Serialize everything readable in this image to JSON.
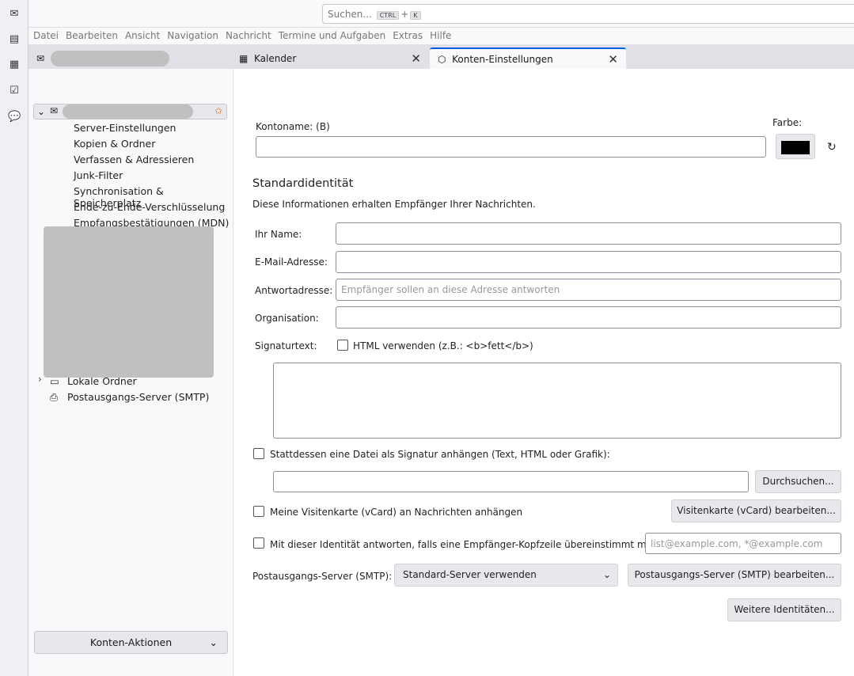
{
  "search": {
    "placeholder": "Suchen...",
    "key1": "CTRL",
    "plus": "+",
    "key2": "K"
  },
  "menu": [
    "Datei",
    "Bearbeiten",
    "Ansicht",
    "Navigation",
    "Nachricht",
    "Termine und Aufgaben",
    "Extras",
    "Hilfe"
  ],
  "tabs": [
    {
      "label": "Kalender"
    },
    {
      "label": "Konten-Einstellungen"
    }
  ],
  "sidebar": {
    "items": [
      "Server-Einstellungen",
      "Kopien & Ordner",
      "Verfassen & Adressieren",
      "Junk-Filter",
      "Synchronisation & Speicherplatz",
      "Ende-zu-Ende-Verschlüsselung",
      "Empfangsbestätigungen (MDN)"
    ],
    "local": "Lokale Ordner",
    "smtp": "Postausgangs-Server (SMTP)",
    "actions": "Konten-Aktionen"
  },
  "form": {
    "kontoname": "Kontoname: (B)",
    "farbe": "Farbe:",
    "color": "#000000",
    "heading": "Standardidentität",
    "desc": "Diese Informationen erhalten Empfänger Ihrer Nachrichten.",
    "name": "Ihr Name:",
    "email": "E-Mail-Adresse:",
    "reply": "Antwortadresse:",
    "reply_ph": "Empfänger sollen an diese Adresse antworten",
    "org": "Organisation:",
    "sig": "Signaturtext:",
    "html": "HTML verwenden (z.B.: <b>fett</b>)",
    "sigfile": "Stattdessen eine Datei als Signatur anhängen (Text, HTML oder Grafik):",
    "browse": "Durchsuchen...",
    "vcard": "Meine Visitenkarte (vCard) an Nachrichten anhängen",
    "vcard_btn": "Visitenkarte (vCard) bearbeiten...",
    "match": "Mit dieser Identität antworten, falls eine Empfänger-Kopfzeile übereinstimmt mit:",
    "match_ph": "list@example.com, *@example.com",
    "smtp": "Postausgangs-Server (SMTP):",
    "smtp_val": "Standard-Server verwenden",
    "smtp_btn": "Postausgangs-Server (SMTP) bearbeiten...",
    "more": "Weitere Identitäten..."
  }
}
